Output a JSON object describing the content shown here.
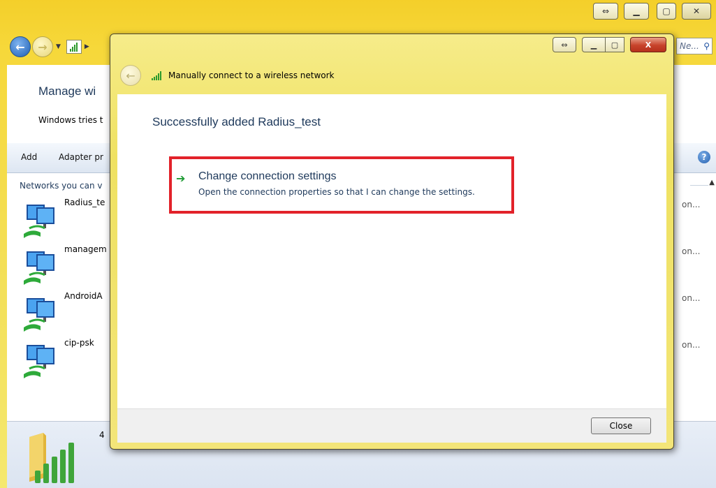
{
  "background_window": {
    "caption": {
      "resize_icon": "⇔",
      "minimize_icon": "▁",
      "maximize_icon": "▢",
      "close_icon": "✕"
    },
    "search_placeholder": "Ne...",
    "title": "Manage wi",
    "description": "Windows tries t",
    "toolbar": {
      "add_label": "Add",
      "adapter_label": "Adapter pr"
    },
    "networks_header": "Networks you can v",
    "networks": [
      {
        "name": "Radius_te",
        "status": "on..."
      },
      {
        "name": "managem",
        "status": "on..."
      },
      {
        "name": "AndroidA",
        "status": "on..."
      },
      {
        "name": "cip-psk",
        "status": "on..."
      }
    ],
    "item_count": "4"
  },
  "dialog": {
    "title": "Manually connect to a wireless network",
    "caption": {
      "resize_icon": "⇔",
      "minimize_icon": "▁",
      "maximize_icon": "▢",
      "close_icon": "X"
    },
    "success_message": "Successfully added Radius_test",
    "option": {
      "title": "Change connection settings",
      "description": "Open the connection properties so that I can change the settings."
    },
    "close_label": "Close"
  },
  "colors": {
    "highlight": "#e2222a",
    "heading": "#1e395b",
    "accent_green": "#1e9b34"
  }
}
